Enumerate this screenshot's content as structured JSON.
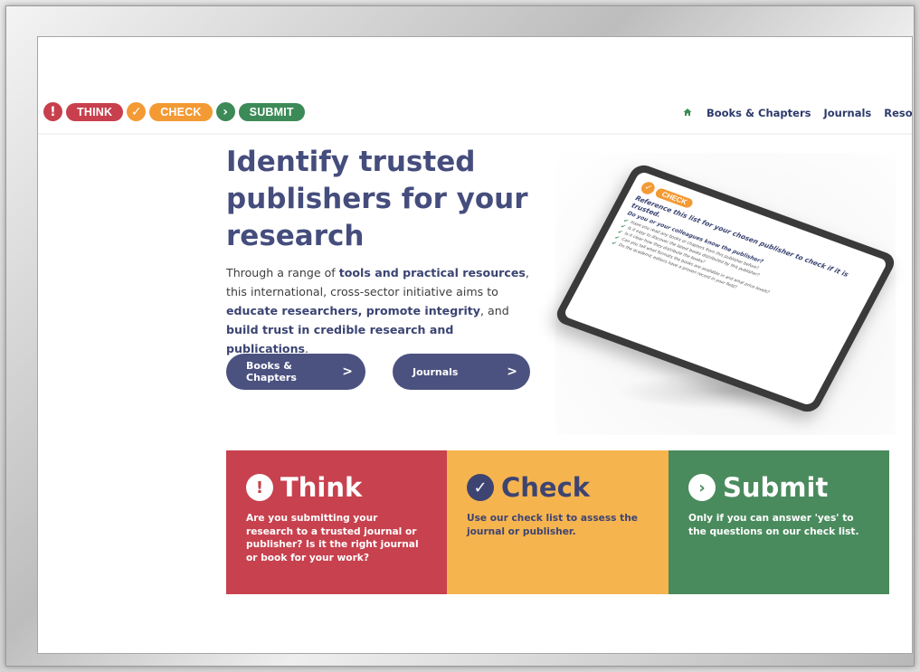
{
  "logo": {
    "think": {
      "icon": "!",
      "label": "THINK"
    },
    "check": {
      "icon": "✓",
      "label": "CHECK"
    },
    "submit": {
      "icon": "›",
      "label": "SUBMIT"
    }
  },
  "nav": {
    "home_icon": "home-icon",
    "items": [
      "Books & Chapters",
      "Journals",
      "Resources"
    ]
  },
  "hero": {
    "title": "Identify trusted publishers for your research",
    "text_parts": [
      "Through a range of ",
      "tools and practical resources",
      ", this international, cross-sector initiative aims to ",
      "educate researchers, promote integrity",
      ", and ",
      "build trust in credible research and publications",
      "."
    ],
    "buttons": [
      {
        "label": "Books & Chapters",
        "chevron": ">"
      },
      {
        "label": "Journals",
        "chevron": ">"
      }
    ]
  },
  "tablet": {
    "badge_icon": "✓",
    "badge_label": "CHECK",
    "heading": "Reference this list for your chosen publisher to check if it is trusted.",
    "subheading": "Do you or your colleagues know the publisher?",
    "items": [
      "Have you read any books or chapters from this publisher before?",
      "Is it easy to discover the latest books distributed by this publisher?",
      "Is it clear how they distribute the books?",
      "Can you tell what formats the books are available in and what price levels?",
      "Do the academic editors have a proven record in your field?"
    ]
  },
  "cards": [
    {
      "icon": "!",
      "title": "Think",
      "text": "Are you submitting your research to a trusted journal or publisher? Is it the right journal or book for your work?"
    },
    {
      "icon": "✓",
      "title": "Check",
      "text": "Use our check list to assess the journal or publisher."
    },
    {
      "icon": "›",
      "title": "Submit",
      "text": "Only if you can answer 'yes' to the questions on our check list."
    }
  ],
  "colors": {
    "think_red": "#c8414e",
    "check_orange": "#f6b44e",
    "submit_green": "#4a8b5e",
    "navy": "#454d7d"
  }
}
